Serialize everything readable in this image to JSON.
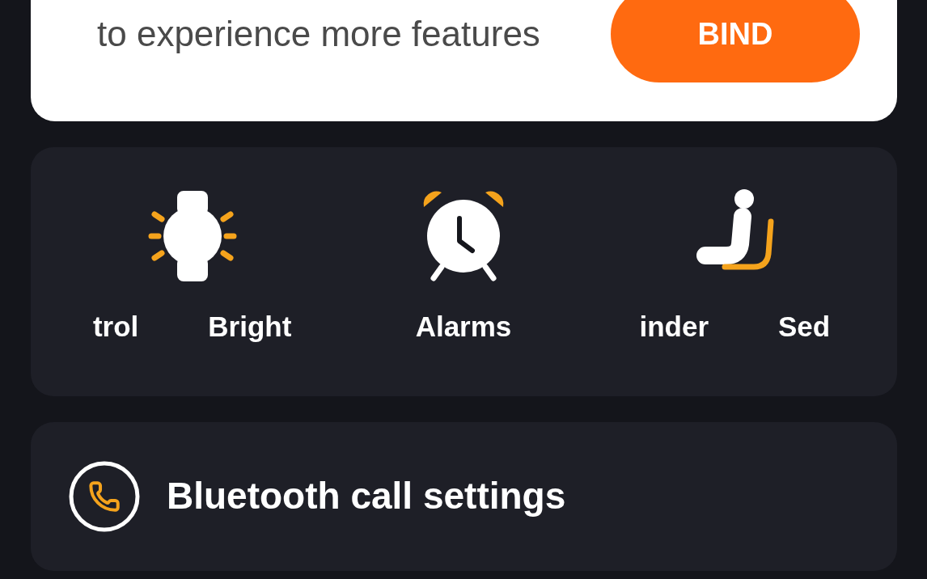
{
  "bind_banner": {
    "message": "to experience more features",
    "button": "BIND"
  },
  "features": [
    {
      "kind": "brightness",
      "labels": [
        "trol",
        "Bright"
      ]
    },
    {
      "kind": "alarm",
      "labels": [
        "Alarms"
      ]
    },
    {
      "kind": "sedentary",
      "labels": [
        "inder",
        "Sed"
      ]
    }
  ],
  "call_settings": {
    "label": "Bluetooth call settings"
  }
}
